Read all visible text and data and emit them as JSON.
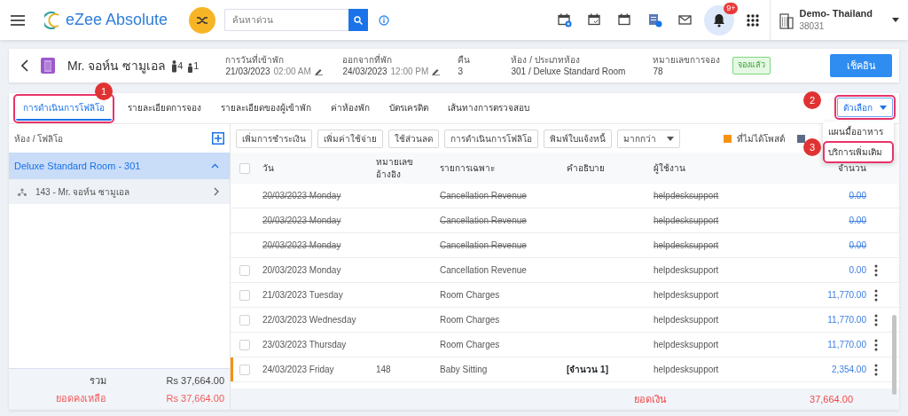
{
  "header": {
    "logo_text": "eZee Absolute",
    "search": {
      "placeholder": "ค้นหาด่วน"
    },
    "notification_badge": "9+",
    "property": {
      "name": "Demo- Thailand",
      "code": "38031"
    }
  },
  "guest": {
    "name": "Mr. จอห์น ซามูเอล",
    "adults": "4",
    "children": "1",
    "fields": [
      {
        "label": "การวันที่เข้าพัก",
        "value": "21/03/2023",
        "time": "02:00 AM",
        "editable": true
      },
      {
        "label": "ออกจากที่พัก",
        "value": "24/03/2023",
        "time": "12:00 PM",
        "editable": true
      },
      {
        "label": "คืน",
        "value": "3",
        "editable": false
      },
      {
        "label": "ห้อง / ประเภทห้อง",
        "value": "301 / Deluxe Standard Room",
        "editable": false
      },
      {
        "label": "หมายเลขการจอง",
        "value": "78",
        "editable": false
      }
    ],
    "status": "จองแล้ว",
    "action": "เช็คอิน"
  },
  "tabs": [
    {
      "label": "การดำเนินการโฟลิโอ",
      "selected": true,
      "highlighted": true
    },
    {
      "label": "รายละเอียดการจอง",
      "selected": false,
      "highlighted": false
    },
    {
      "label": "รายละเอียดของผู้เข้าพัก",
      "selected": false,
      "highlighted": false
    },
    {
      "label": "ค่าห้องพัก",
      "selected": false,
      "highlighted": false
    },
    {
      "label": "บัตรเครดิต",
      "selected": false,
      "highlighted": false
    },
    {
      "label": "เส้นทางการตรวจสอบ",
      "selected": false,
      "highlighted": false
    }
  ],
  "options_button": {
    "label": "ตัวเลือก",
    "highlighted": true
  },
  "options_menu": [
    {
      "label": "แผนมื้ออาหาร",
      "highlighted": false
    },
    {
      "label": "บริการเพิ่มเติม",
      "highlighted": true
    }
  ],
  "annotations": [
    {
      "label": "1"
    },
    {
      "label": "2"
    },
    {
      "label": "3"
    }
  ],
  "sidebar": {
    "title": "ห้อง / โฟลิโอ",
    "rooms": [
      {
        "label": "Deluxe Standard Room - 301",
        "expanded": true,
        "children": [
          {
            "label": "143 - Mr. จอห์น ซามูเอล"
          }
        ]
      }
    ],
    "totals": [
      {
        "label": "รวม",
        "value": "Rs 37,664.00",
        "kind": "total"
      },
      {
        "label": "ยอดคงเหลือ",
        "value": "Rs 37,664.00",
        "kind": "balance"
      }
    ]
  },
  "toolbar": [
    {
      "label": "เพิ่มการชำระเงิน",
      "kind": "button"
    },
    {
      "label": "เพิ่มค่าใช้จ่าย",
      "kind": "button"
    },
    {
      "label": "ใช้ส่วนลด",
      "kind": "button"
    },
    {
      "label": "การดำเนินการโฟลิโอ",
      "kind": "button"
    },
    {
      "label": "พิมพ์ใบแจ้งหนี้",
      "kind": "button"
    },
    {
      "label": "มากกว่า",
      "kind": "dropdown"
    }
  ],
  "legend": [
    {
      "label": "ที่ไม่ได้โพสต์",
      "color": "#f39410"
    },
    {
      "color": "#5b6b86"
    }
  ],
  "table": {
    "select_all": {
      "checked": false
    },
    "columns": [
      "วัน",
      "หมายเลข อ้างอิง",
      "รายการเฉพาะ",
      "คำอธิบาย",
      "ผู้ใช้งาน",
      "จำนวน"
    ],
    "rows": [
      {
        "date": "20/03/2023 Monday",
        "particular": "Cancellation Revenue",
        "user": "helpdesksupport",
        "amount": "0.00",
        "void": true,
        "unposted": false
      },
      {
        "date": "20/03/2023 Monday",
        "particular": "Cancellation Revenue",
        "user": "helpdesksupport",
        "amount": "0.00",
        "void": true,
        "unposted": false
      },
      {
        "date": "20/03/2023 Monday",
        "particular": "Cancellation Revenue",
        "user": "helpdesksupport",
        "amount": "0.00",
        "void": true,
        "unposted": false
      },
      {
        "date": "20/03/2023 Monday",
        "particular": "Cancellation Revenue",
        "user": "helpdesksupport",
        "amount": "0.00",
        "void": false,
        "unposted": false,
        "checked": false
      },
      {
        "date": "21/03/2023 Tuesday",
        "particular": "Room Charges",
        "user": "helpdesksupport",
        "amount": "11,770.00",
        "void": false,
        "unposted": false,
        "checked": false
      },
      {
        "date": "22/03/2023 Wednesday",
        "particular": "Room Charges",
        "user": "helpdesksupport",
        "amount": "11,770.00",
        "void": false,
        "unposted": false,
        "checked": false
      },
      {
        "date": "23/03/2023 Thursday",
        "particular": "Room Charges",
        "user": "helpdesksupport",
        "amount": "11,770.00",
        "void": false,
        "unposted": false,
        "checked": false
      },
      {
        "date": "24/03/2023 Friday",
        "ref": "148",
        "particular": "Baby Sitting",
        "description": "[จำนวน 1]",
        "user": "helpdesksupport",
        "amount": "2,354.00",
        "void": false,
        "unposted": true,
        "checked": false
      }
    ],
    "footer": {
      "label": "ยอดเงิน",
      "value": "37,664.00"
    }
  }
}
